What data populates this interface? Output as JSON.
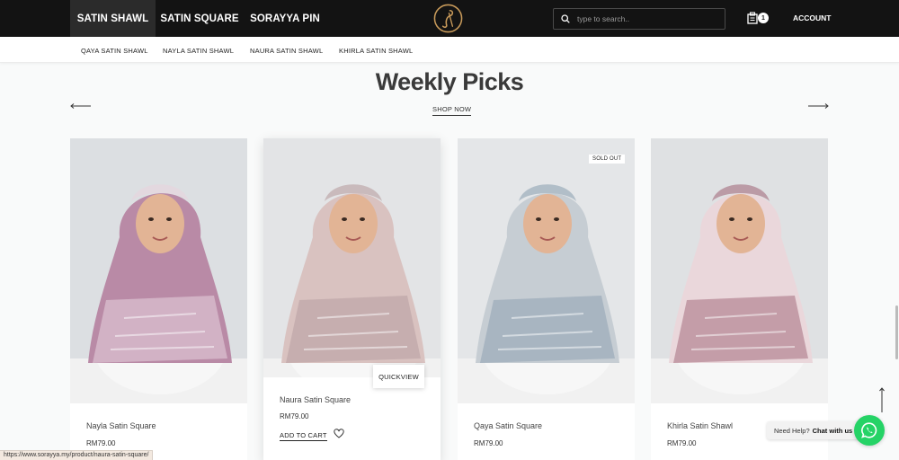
{
  "nav": {
    "tabs": [
      {
        "label": "SATIN SHAWL",
        "active": true
      },
      {
        "label": "SATIN SQUARE",
        "active": false
      },
      {
        "label": "SORAYYA PIN",
        "active": false
      }
    ],
    "search_placeholder": "type to search..",
    "cart_count": "1",
    "account_label": "ACCOUNT"
  },
  "subnav": {
    "items": [
      "QAYA SATIN SHAWL",
      "NAYLA SATIN SHAWL",
      "NAURA SATIN SHAWL",
      "KHIRLA SATIN SHAWL"
    ]
  },
  "section": {
    "title": "Weekly Picks",
    "cta": "SHOP NOW"
  },
  "products": [
    {
      "name": "Nayla Satin Square",
      "price": "RM79.00",
      "scarf_color": "#b98aa6",
      "accent": "#e8d3de"
    },
    {
      "name": "Naura Satin Square",
      "price": "RM79.00",
      "scarf_color": "#d9c2c0",
      "accent": "#b79ea0",
      "add_to_cart": "ADD TO CART",
      "quickview": "QUICKVIEW"
    },
    {
      "name": "Qaya Satin Square",
      "price": "RM79.00",
      "scarf_color": "#c6cdd3",
      "accent": "#8fa3b3",
      "badge": "SOLD OUT"
    },
    {
      "name": "Khirla Satin Shawl",
      "price": "RM79.00",
      "scarf_color": "#ead7db",
      "accent": "#a46d7d"
    }
  ],
  "help": {
    "text": "Need Help?",
    "link": "Chat with us"
  },
  "status_url": "https://www.sorayya.my/product/naura-satin-square/",
  "colors": {
    "topbar": "#131313",
    "whatsapp": "#25d366",
    "logo_gold": "#c89a5a"
  }
}
